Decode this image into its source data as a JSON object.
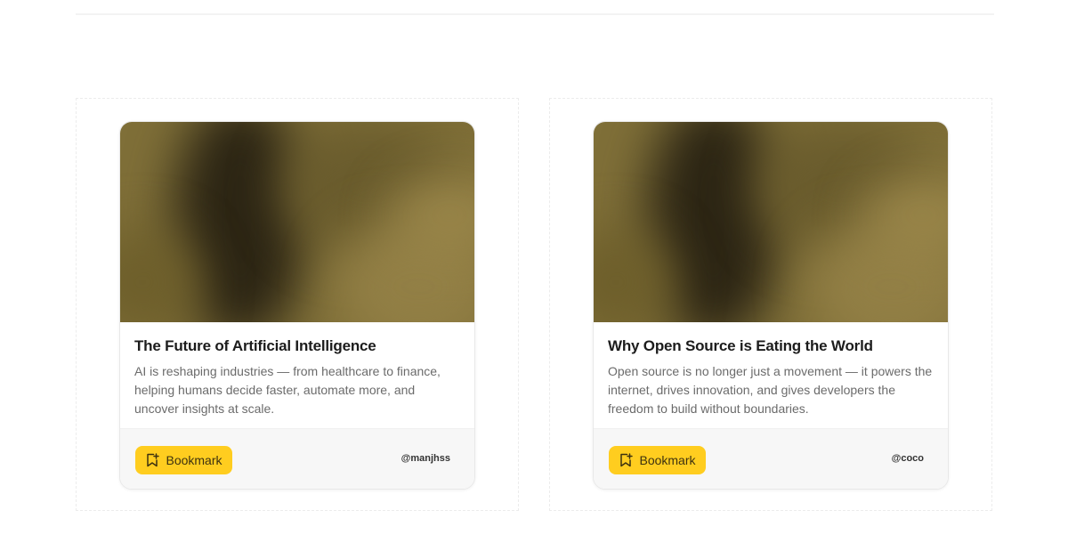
{
  "cards": [
    {
      "title": "The Future of Artificial Intelligence",
      "description": "AI is reshaping industries — from healthcare to finance, helping humans decide faster, automate more, and uncover insights at scale.",
      "bookmark_label": "Bookmark",
      "author": "@manjhss"
    },
    {
      "title": "Why Open Source is Eating the World",
      "description": "Open source is no longer just a movement — it powers the internet, drives innovation, and gives developers the freedom to build without boundaries.",
      "bookmark_label": "Bookmark",
      "author": "@coco"
    }
  ],
  "icons": {
    "bookmark": "bookmark-add-icon"
  },
  "colors": {
    "accent": "#ffcd1f",
    "image_tone": "#7f6f38"
  }
}
